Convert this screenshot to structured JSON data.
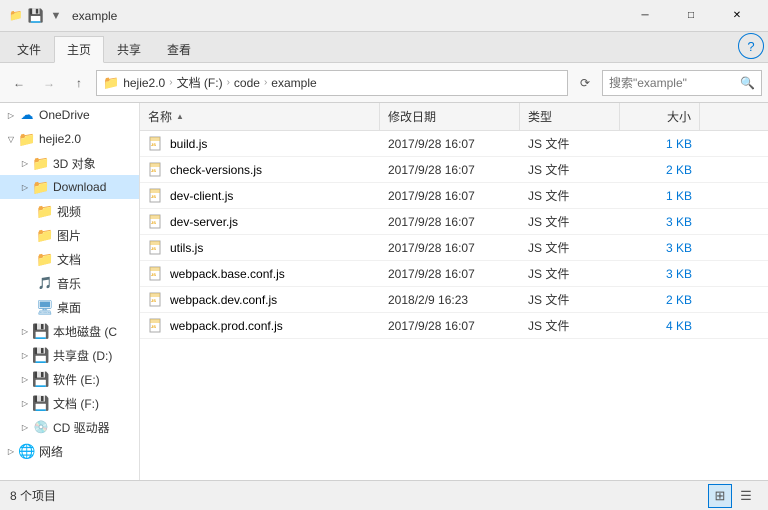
{
  "titleBar": {
    "title": "example",
    "icons": [
      "📁"
    ],
    "minimizeLabel": "─",
    "maximizeLabel": "□",
    "closeLabel": "✕"
  },
  "ribbon": {
    "tabs": [
      "文件",
      "主页",
      "共享",
      "查看"
    ],
    "activeTab": "主页"
  },
  "addressBar": {
    "backLabel": "←",
    "forwardLabel": "→",
    "upLabel": "↑",
    "parts": [
      "hejie2.0",
      "文档 (F:)",
      "code",
      "example"
    ],
    "refreshLabel": "⟳",
    "searchPlaceholder": "搜索\"example\"",
    "searchIconLabel": "🔍"
  },
  "sidebar": {
    "items": [
      {
        "label": "OneDrive",
        "icon": "onedrive",
        "indent": 1,
        "expandable": true,
        "expanded": false
      },
      {
        "label": "hejie2.0",
        "icon": "folder",
        "indent": 1,
        "expandable": true,
        "expanded": true
      },
      {
        "label": "3D 对象",
        "icon": "folder-3d",
        "indent": 2,
        "expandable": true,
        "expanded": false
      },
      {
        "label": "Download",
        "icon": "folder",
        "indent": 2,
        "expandable": true,
        "expanded": false
      },
      {
        "label": "视频",
        "icon": "folder",
        "indent": 2,
        "expandable": false
      },
      {
        "label": "图片",
        "icon": "folder",
        "indent": 2,
        "expandable": false
      },
      {
        "label": "文档",
        "icon": "folder",
        "indent": 2,
        "expandable": false
      },
      {
        "label": "音乐",
        "icon": "folder-music",
        "indent": 2,
        "expandable": false
      },
      {
        "label": "桌面",
        "icon": "folder",
        "indent": 2,
        "expandable": false
      },
      {
        "label": "本地磁盘 (C",
        "icon": "drive",
        "indent": 2,
        "expandable": true,
        "expanded": false
      },
      {
        "label": "共享盘 (D:)",
        "icon": "drive",
        "indent": 2,
        "expandable": true,
        "expanded": false
      },
      {
        "label": "软件 (E:)",
        "icon": "drive",
        "indent": 2,
        "expandable": true,
        "expanded": false
      },
      {
        "label": "文档 (F:)",
        "icon": "drive",
        "indent": 2,
        "expandable": true,
        "expanded": false
      },
      {
        "label": "CD 驱动器",
        "icon": "drive-cd",
        "indent": 2,
        "expandable": true,
        "expanded": false
      },
      {
        "label": "网络",
        "icon": "network",
        "indent": 1,
        "expandable": true,
        "expanded": false
      }
    ]
  },
  "fileList": {
    "columns": [
      {
        "label": "名称",
        "key": "name",
        "sortable": true
      },
      {
        "label": "修改日期",
        "key": "date",
        "sortable": true
      },
      {
        "label": "类型",
        "key": "type",
        "sortable": true
      },
      {
        "label": "大小",
        "key": "size",
        "sortable": true
      }
    ],
    "files": [
      {
        "name": "build.js",
        "date": "2017/9/28 16:07",
        "type": "JS 文件",
        "size": "1 KB"
      },
      {
        "name": "check-versions.js",
        "date": "2017/9/28 16:07",
        "type": "JS 文件",
        "size": "2 KB"
      },
      {
        "name": "dev-client.js",
        "date": "2017/9/28 16:07",
        "type": "JS 文件",
        "size": "1 KB"
      },
      {
        "name": "dev-server.js",
        "date": "2017/9/28 16:07",
        "type": "JS 文件",
        "size": "3 KB"
      },
      {
        "name": "utils.js",
        "date": "2017/9/28 16:07",
        "type": "JS 文件",
        "size": "3 KB"
      },
      {
        "name": "webpack.base.conf.js",
        "date": "2017/9/28 16:07",
        "type": "JS 文件",
        "size": "3 KB"
      },
      {
        "name": "webpack.dev.conf.js",
        "date": "2018/2/9 16:23",
        "type": "JS 文件",
        "size": "2 KB"
      },
      {
        "name": "webpack.prod.conf.js",
        "date": "2017/9/28 16:07",
        "type": "JS 文件",
        "size": "4 KB"
      }
    ]
  },
  "statusBar": {
    "itemCount": "8 个项目",
    "viewDetailLabel": "▦",
    "viewListLabel": "▤"
  }
}
